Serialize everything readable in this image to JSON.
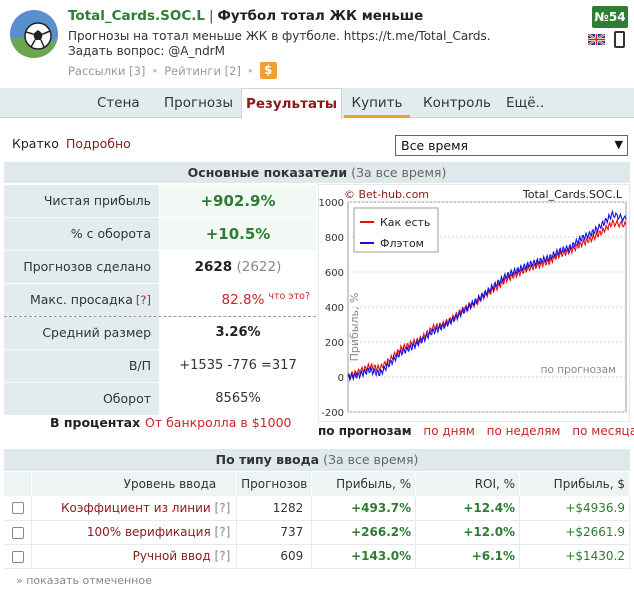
{
  "header": {
    "name": "Total_Cards.SOC.L",
    "separator": "|",
    "subtitle": "Футбол тотал ЖК меньше",
    "description": "Прогнозы на тотал меньше ЖК в футболе. https://t.me/Total_Cards. Задать вопрос: @A_ndrM",
    "mailings": "Рассылки [3]",
    "ratings": "Рейтинги [2]",
    "dollar": "$",
    "rank": "№54"
  },
  "nav": {
    "items": [
      "Стена",
      "Прогнозы",
      "Результаты",
      "Купить",
      "Контроль",
      "Ещё.."
    ],
    "active": "Результаты"
  },
  "filter": {
    "brief": "Кратко",
    "detailed": "Подробно",
    "period": "Все время",
    "arrow": "▼"
  },
  "main_panel": {
    "title": "Основные показатели",
    "period": "(За все время)"
  },
  "stats": [
    {
      "label": "Чистая прибыль",
      "value": "+902.9%"
    },
    {
      "label": "% с оборота",
      "value": "+10.5%"
    },
    {
      "label": "Прогнозов сделано",
      "value": "2628",
      "extra": "(2622)"
    },
    {
      "label": "Макс. просадка",
      "help": "[?]",
      "value": "82.8%",
      "note": "что это?"
    },
    {
      "label": "Средний размер",
      "value": "3.26%"
    },
    {
      "label": "В/П",
      "value": "+1535 -776 =317"
    },
    {
      "label": "Оборот",
      "value": "8565%"
    }
  ],
  "percent_tabs": {
    "in_percent": "В процентах",
    "from_bankroll": "От банкролла в $1000"
  },
  "chart_data": {
    "type": "line",
    "watermark": "© Bet-hub.com",
    "name_label": "Total_Cards.SOC.L",
    "ylabel": "Прибыль, %",
    "xlabel": "по прогнозам",
    "ylim": [
      -200,
      1000
    ],
    "yticks": [
      1000,
      800,
      600,
      400,
      200,
      0,
      -200
    ],
    "x": [
      0,
      100,
      200,
      300,
      400,
      500,
      600,
      700,
      800,
      900,
      1000,
      1100,
      1200,
      1300,
      1400,
      1500,
      1600,
      1700,
      1800,
      1900,
      2000,
      2100,
      2200,
      2300,
      2400,
      2500,
      2628
    ],
    "series": [
      {
        "name": "Как есть",
        "color": "#e01010",
        "values": [
          0,
          30,
          60,
          50,
          100,
          160,
          190,
          220,
          280,
          300,
          340,
          390,
          420,
          470,
          510,
          560,
          590,
          620,
          640,
          660,
          700,
          720,
          760,
          790,
          830,
          880,
          870
        ]
      },
      {
        "name": "Флэтом",
        "color": "#1010e0",
        "values": [
          0,
          10,
          40,
          20,
          80,
          140,
          170,
          210,
          260,
          290,
          330,
          380,
          430,
          480,
          530,
          580,
          610,
          640,
          660,
          680,
          720,
          740,
          790,
          820,
          870,
          930,
          900
        ]
      }
    ],
    "legend": "top-left"
  },
  "chart_tabs": [
    "по прогнозам",
    "по дням",
    "по неделям",
    "по месяцам"
  ],
  "type_panel": {
    "title": "По типу ввода",
    "period": "(За все время)"
  },
  "type_table": {
    "headers": [
      "",
      "Уровень ввода",
      "Прогнозов",
      "Прибыль, %",
      "ROI, %",
      "Прибыль, $"
    ],
    "rows": [
      {
        "label": "Коэффициент из линии",
        "help": "[?]",
        "count": "1282",
        "profit_pct": "+493.7%",
        "roi": "+12.4%",
        "profit_usd": "+$4936.9"
      },
      {
        "label": "100% верификация",
        "help": "[?]",
        "count": "737",
        "profit_pct": "+266.2%",
        "roi": "+12.0%",
        "profit_usd": "+$2661.9"
      },
      {
        "label": "Ручной ввод",
        "help": "[?]",
        "count": "609",
        "profit_pct": "+143.0%",
        "roi": "+6.1%",
        "profit_usd": "+$1430.2"
      }
    ],
    "show_marked": "» показать отмеченное"
  },
  "colors": {
    "green": "#2e7d32",
    "red": "#c62828",
    "dark_red": "#8b1a1a",
    "accent_orange": "#f0a030",
    "panel_bg": "#e2ecef"
  }
}
